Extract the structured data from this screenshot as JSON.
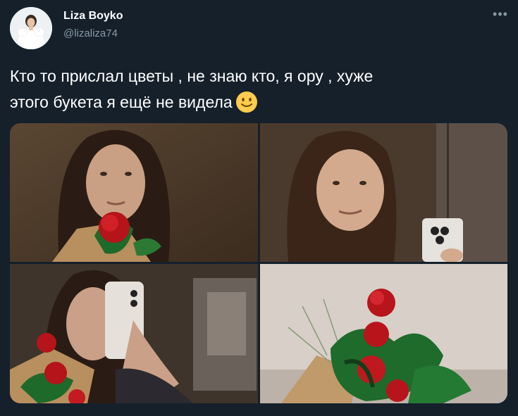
{
  "author": {
    "display_name": "Liza Boyko",
    "handle": "@lizaliza74",
    "avatar_icon": "profile-avatar"
  },
  "menu": {
    "more_label": "•••"
  },
  "tweet": {
    "line1": "Кто то прислал цветы , не знаю кто, я ору , хуже",
    "line2": "этого букета я ещё не видела",
    "emoji": "slightly-smiling-face-emoji"
  },
  "media": {
    "photo_count": 4,
    "photos": [
      {
        "subject": "selfie-with-rose"
      },
      {
        "subject": "elevator-mirror-selfie"
      },
      {
        "subject": "mirror-selfie-with-bouquet"
      },
      {
        "subject": "rose-bouquet"
      }
    ]
  },
  "colors": {
    "background": "#15202b",
    "text": "#ffffff",
    "secondary_text": "#8899a6"
  }
}
